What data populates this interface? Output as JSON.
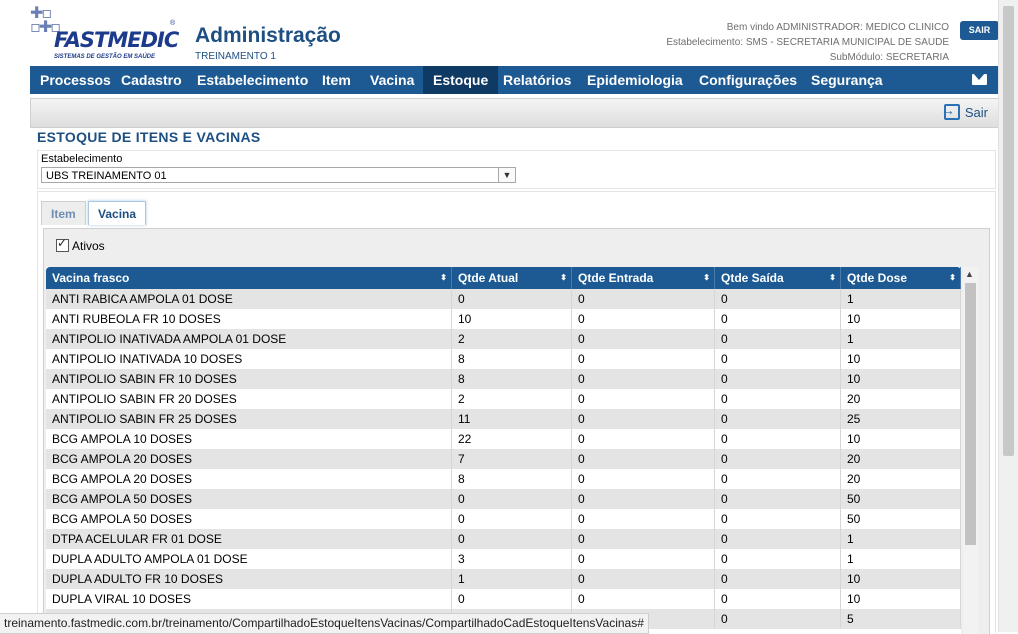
{
  "app": {
    "title": "Administração",
    "subtitle": "TREINAMENTO 1",
    "logo_name": "FASTMEDIC",
    "logo_tagline": "SISTEMAS DE GESTÃO EM SAÚDE",
    "logo_reg": "®"
  },
  "user": {
    "welcome": "Bem vindo ADMINISTRADOR: MEDICO CLINICO",
    "estabelecimento": "Estabelecimento: SMS - SECRETARIA MUNICIPAL DE SAUDE",
    "submodulo": "SubMódulo: SECRETARIA",
    "logout_label": "SAIR"
  },
  "menu": {
    "items": [
      "Processos",
      "Cadastro",
      "Estabelecimento",
      "Item",
      "Vacina",
      "Estoque",
      "Relatórios",
      "Epidemiologia",
      "Configurações",
      "Segurança"
    ],
    "active": "Estoque",
    "mail_icon": "envelope-icon"
  },
  "toolbar": {
    "exit_label": "Sair"
  },
  "page": {
    "section_title": "ESTOQUE DE ITENS E VACINAS",
    "estab_label": "Estabelecimento",
    "estab_value": "UBS TREINAMENTO 01"
  },
  "tabs": [
    {
      "label": "Item"
    },
    {
      "label": "Vacina"
    }
  ],
  "active_tab": "Vacina",
  "filter": {
    "ativos_label": "Ativos",
    "ativos_checked": true
  },
  "grid": {
    "columns": [
      "Vacina frasco",
      "Qtde Atual",
      "Qtde Entrada",
      "Qtde Saída",
      "Qtde Dose"
    ],
    "rows": [
      [
        "ANTI RABICA AMPOLA 01 DOSE",
        "0",
        "0",
        "0",
        "1"
      ],
      [
        "ANTI RUBEOLA FR 10 DOSES",
        "10",
        "0",
        "0",
        "10"
      ],
      [
        "ANTIPOLIO INATIVADA AMPOLA 01 DOSE",
        "2",
        "0",
        "0",
        "1"
      ],
      [
        "ANTIPOLIO INATIVADA 10 DOSES",
        "8",
        "0",
        "0",
        "10"
      ],
      [
        "ANTIPOLIO SABIN FR 10 DOSES",
        "8",
        "0",
        "0",
        "10"
      ],
      [
        "ANTIPOLIO SABIN FR 20 DOSES",
        "2",
        "0",
        "0",
        "20"
      ],
      [
        "ANTIPOLIO SABIN FR 25 DOSES",
        "11",
        "0",
        "0",
        "25"
      ],
      [
        "BCG AMPOLA 10 DOSES",
        "22",
        "0",
        "0",
        "10"
      ],
      [
        "BCG AMPOLA 20 DOSES",
        "7",
        "0",
        "0",
        "20"
      ],
      [
        "BCG AMPOLA 20 DOSES",
        "8",
        "0",
        "0",
        "20"
      ],
      [
        "BCG AMPOLA 50 DOSES",
        "0",
        "0",
        "0",
        "50"
      ],
      [
        "BCG AMPOLA 50 DOSES",
        "0",
        "0",
        "0",
        "50"
      ],
      [
        "DTPA ACELULAR FR 01 DOSE",
        "0",
        "0",
        "0",
        "1"
      ],
      [
        "DUPLA ADULTO AMPOLA 01 DOSE",
        "3",
        "0",
        "0",
        "1"
      ],
      [
        "DUPLA ADULTO FR 10 DOSES",
        "1",
        "0",
        "0",
        "10"
      ],
      [
        "DUPLA VIRAL 10 DOSES",
        "0",
        "0",
        "0",
        "10"
      ],
      [
        "",
        "",
        "",
        "0",
        "5"
      ]
    ]
  },
  "statusbar": {
    "url": "treinamento.fastmedic.com.br/treinamento/CompartilhadoEstoqueItensVacinas/CompartilhadoCadEstoqueItensVacinas#"
  }
}
